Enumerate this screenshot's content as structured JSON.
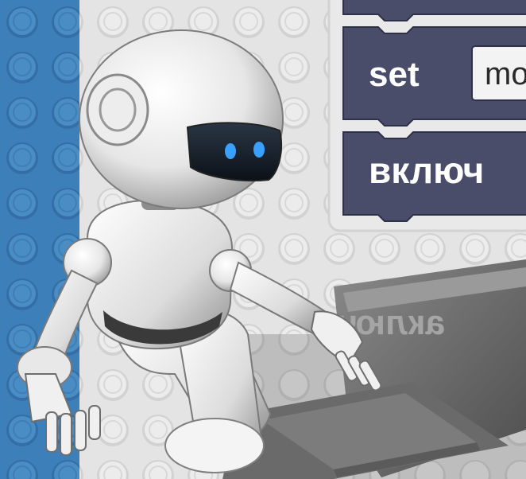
{
  "blocks": {
    "set_label": "set",
    "set_value_partial": "mo",
    "enable_label_partial": "включ"
  },
  "laptop": {
    "screen_text_mirrored": "аключ"
  },
  "colors": {
    "left_stripe": "#3d7fb8",
    "block_panel": "#e9e9e9",
    "block_fill": "#4a4d6a",
    "block_border": "#2f3148",
    "lego_bg": "#e3e3e3",
    "robot_body": "#f2f2f2",
    "robot_visor": "#17202c",
    "robot_eye": "#3aa0ff"
  },
  "icons": {
    "robot": "robot-illustration",
    "laptop": "laptop-illustration"
  }
}
